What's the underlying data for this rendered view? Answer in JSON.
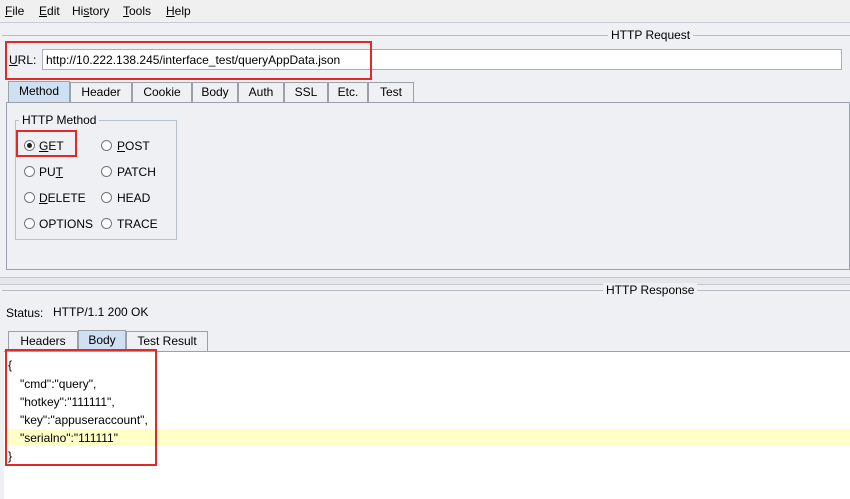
{
  "menu": {
    "items": [
      {
        "label_rest": "ile",
        "mnemonic": "F"
      },
      {
        "label_rest": "dit",
        "mnemonic": "E"
      },
      {
        "label_rest": "istory",
        "mnemonic": "H",
        "full": "History"
      },
      {
        "label_rest": "ools",
        "mnemonic": "T",
        "prefix": ""
      },
      {
        "label_rest": "elp",
        "mnemonic": "H"
      }
    ],
    "file": "File",
    "edit": "Edit",
    "history": "History",
    "tools": "Tools",
    "help": "Help"
  },
  "request": {
    "title": "HTTP Request",
    "url_label": "URL:",
    "url_value": "http://10.222.138.245/interface_test/queryAppData.json",
    "tabs": [
      "Method",
      "Header",
      "Cookie",
      "Body",
      "Auth",
      "SSL",
      "Etc.",
      "Test"
    ],
    "active_tab": "Method",
    "method_group_title": "HTTP Method",
    "methods": [
      "GET",
      "POST",
      "PUT",
      "PATCH",
      "DELETE",
      "HEAD",
      "OPTIONS",
      "TRACE"
    ],
    "selected_method": "GET"
  },
  "response": {
    "title": "HTTP Response",
    "status_label": "Status:",
    "status_value": "HTTP/1.1 200 OK",
    "tabs": [
      "Headers",
      "Body",
      "Test Result"
    ],
    "active_tab": "Body",
    "body_lines": [
      "{",
      "\"cmd\":\"query\",",
      "\"hotkey\":\"111111\",",
      "\"key\":\"appuseraccount\",",
      "\"serialno\":\"111111\"",
      "}"
    ]
  },
  "colors": {
    "highlight": "#e02a2a",
    "active_tab": "#cfe0f3",
    "current_line": "#ffffc8"
  }
}
